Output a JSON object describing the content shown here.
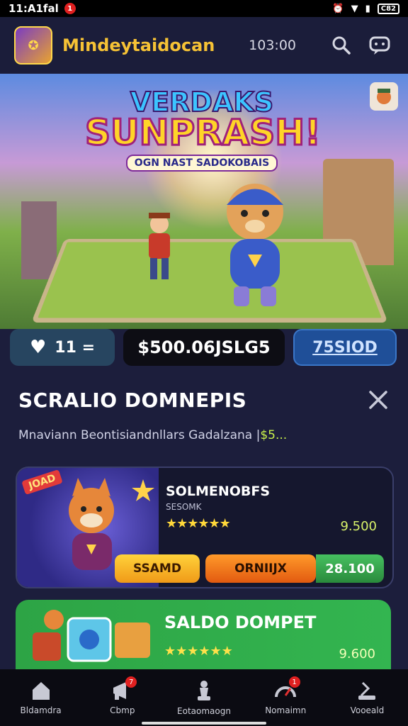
{
  "status_bar": {
    "time": "11:A1fal",
    "notif_badge": "1",
    "battery": "C82"
  },
  "app_bar": {
    "title": "Mindeytaidocan",
    "time": "103:00",
    "icons": [
      "app-logo",
      "search-icon",
      "chat-icon"
    ]
  },
  "hero": {
    "title_line1": "VERDAKS",
    "title_line2": "SUNPRASH!",
    "subtitle": "OGN NAST SADOKOBAIS"
  },
  "stats": {
    "likes": "11 =",
    "money": "$500.06JSLG5",
    "action": "75SIOD"
  },
  "section": {
    "title": "SCRALIO DOMNEPIS",
    "subtitle": "Mnaviann Beontisiandnllars Gadalzana |",
    "subtitle_accent": "$5..."
  },
  "card1": {
    "ribbon": "JOAD",
    "title": "SOLMENOBFS",
    "subtitle": "SESOMK",
    "stars": "★★★★★★",
    "price": "9.500",
    "btn_yellow": "SSAMD",
    "btn_orange": "ORNIIJX",
    "btn_green": "28.100"
  },
  "card2": {
    "title": "SALDO DOMPET",
    "stars": "★★★★★★",
    "price": "9.600"
  },
  "bottom_nav": [
    {
      "label": "Bldamdra",
      "icon": "home-icon"
    },
    {
      "label": "Cbmp",
      "icon": "megaphone-icon",
      "badge": "7"
    },
    {
      "label": "Eotaomaogn",
      "icon": "chess-icon"
    },
    {
      "label": "Nomaimn",
      "icon": "gauge-icon",
      "badge": "1"
    },
    {
      "label": "Vooeald",
      "icon": "user-icon"
    }
  ]
}
